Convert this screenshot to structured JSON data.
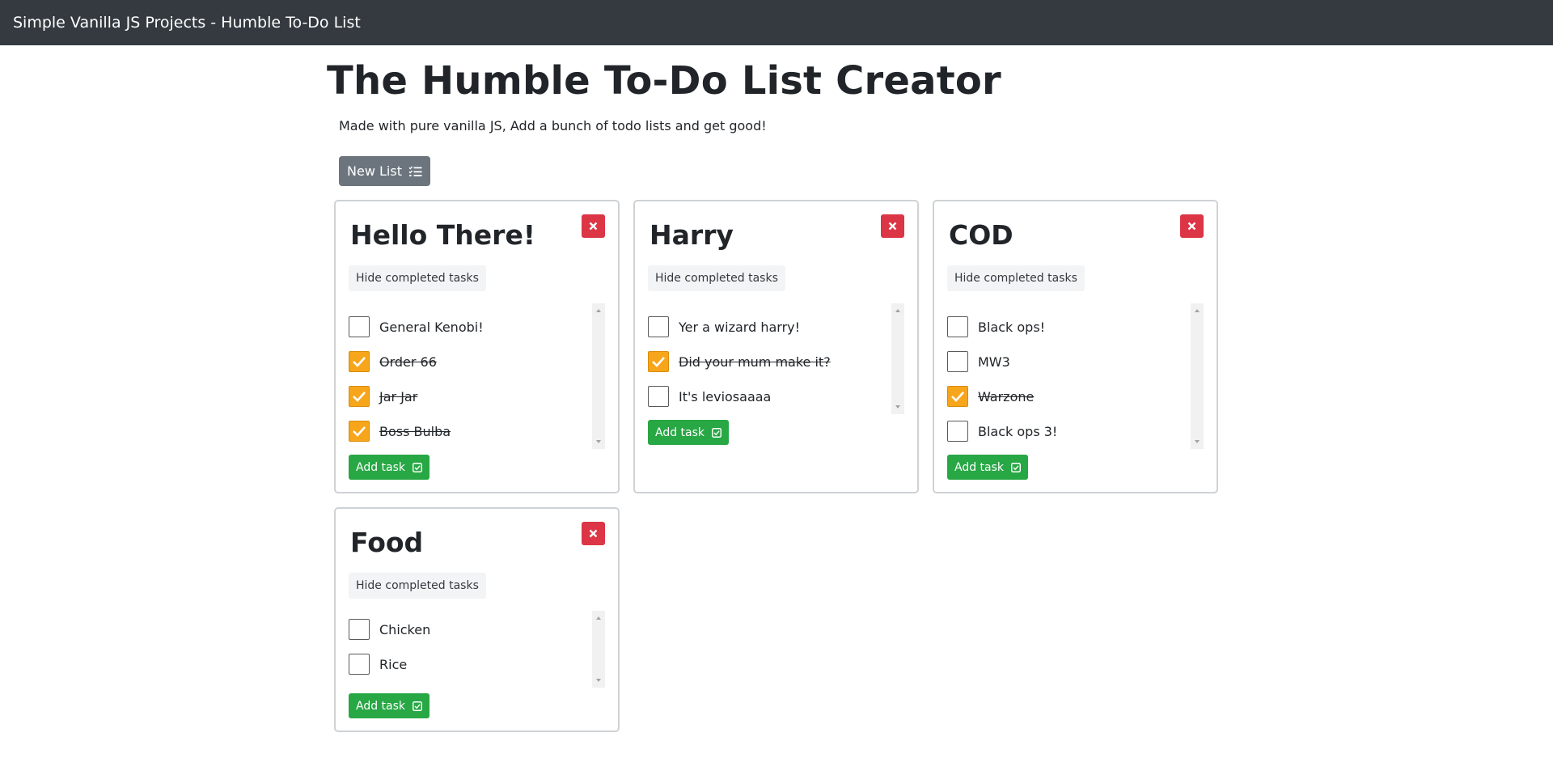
{
  "navbar": {
    "title": "Simple Vanilla JS Projects - Humble To-Do List"
  },
  "header": {
    "title": "The Humble To-Do List Creator",
    "subtitle": "Made with pure vanilla JS, Add a bunch of todo lists and get good!",
    "new_list_label": "New List"
  },
  "lists": [
    {
      "title": "Hello There!",
      "hide_label": "Hide completed tasks",
      "add_label": "Add task",
      "tasks": [
        {
          "label": "General Kenobi!",
          "done": false
        },
        {
          "label": "Order 66",
          "done": true
        },
        {
          "label": "Jar Jar",
          "done": true
        },
        {
          "label": "Boss Bulba",
          "done": true
        }
      ]
    },
    {
      "title": "Harry",
      "hide_label": "Hide completed tasks",
      "add_label": "Add task",
      "tasks": [
        {
          "label": "Yer a wizard harry!",
          "done": false
        },
        {
          "label": "Did your mum make it?",
          "done": true
        },
        {
          "label": "It's leviosaaaa",
          "done": false
        }
      ]
    },
    {
      "title": "COD",
      "hide_label": "Hide completed tasks",
      "add_label": "Add task",
      "tasks": [
        {
          "label": "Black ops!",
          "done": false
        },
        {
          "label": "MW3",
          "done": false
        },
        {
          "label": "Warzone",
          "done": true
        },
        {
          "label": "Black ops 3!",
          "done": false
        }
      ]
    },
    {
      "title": "Food",
      "hide_label": "Hide completed tasks",
      "add_label": "Add task",
      "tasks": [
        {
          "label": "Chicken",
          "done": false
        },
        {
          "label": "Rice",
          "done": false
        }
      ]
    }
  ],
  "colors": {
    "navbar": "#343a40",
    "secondary_button": "#6c757d",
    "delete_button": "#dc3545",
    "add_button": "#28a745",
    "checked_box": "#f7a51a"
  },
  "icons": {
    "new_list": "list-check-icon",
    "delete": "close-icon",
    "add_task": "checkbox-icon",
    "checkbox_checked": "checkmark-icon"
  }
}
